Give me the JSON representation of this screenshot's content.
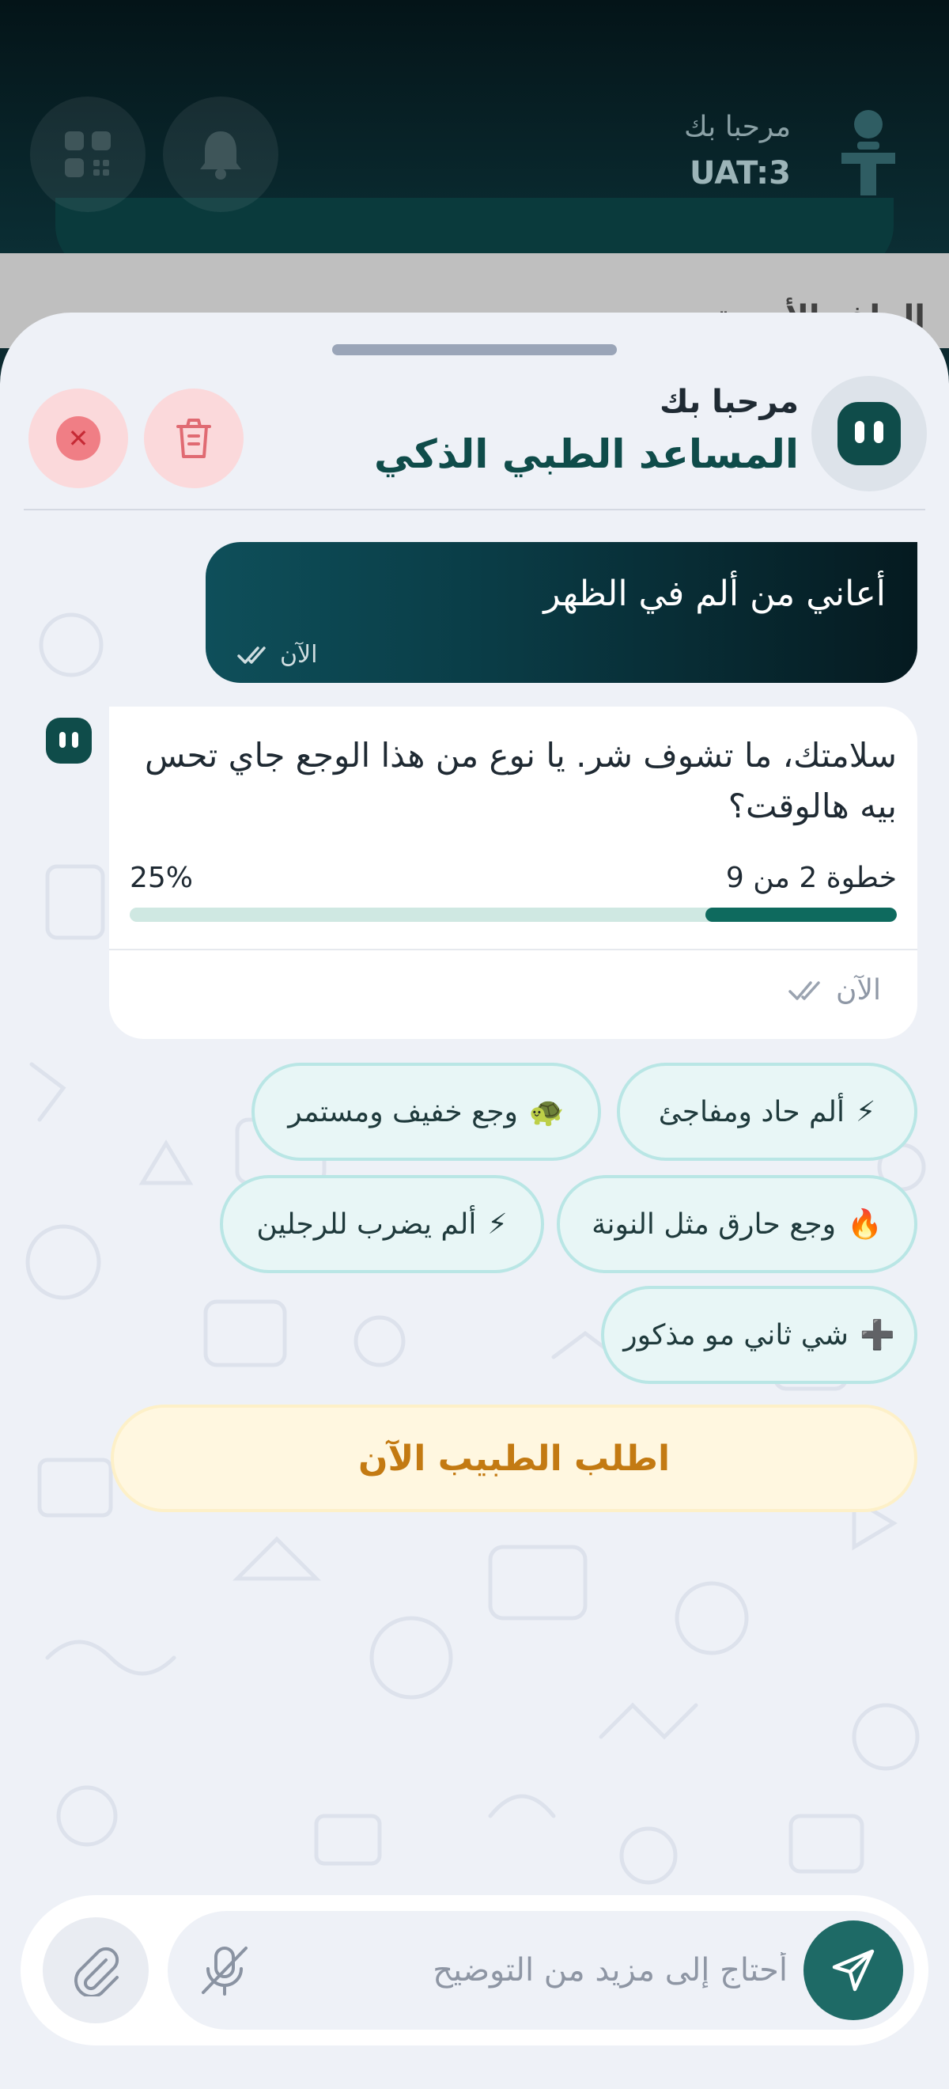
{
  "app_header": {
    "greeting": "مرحبا بك",
    "user_id": "UAT:3",
    "behind_text": "الملف الأسرة"
  },
  "sheet": {
    "greeting": "مرحبا بك",
    "title": "المساعد الطبي الذكي"
  },
  "messages": {
    "user": {
      "text": "أعاني من ألم في الظهر",
      "time": "الآن"
    },
    "bot": {
      "text": "سلامتك، ما تشوف شر. يا نوع من هذا الوجع جاي تحس بيه هالوقت؟",
      "step_label": "خطوة 2 من 9",
      "percent_label": "25%",
      "progress_fraction": 0.25,
      "time": "الآن"
    }
  },
  "options": [
    {
      "emoji": "⚡",
      "label": "ألم حاد ومفاجئ"
    },
    {
      "emoji": "🐢",
      "label": "وجع خفيف ومستمر"
    },
    {
      "emoji": "🔥",
      "label": "وجع حارق مثل النونة"
    },
    {
      "emoji": "⚡",
      "label": "ألم يضرب للرجلين"
    },
    {
      "emoji": "➕",
      "label": "شي ثاني مو مذكور"
    }
  ],
  "doctor_button": "اطلب الطبيب الآن",
  "composer": {
    "placeholder": "أحتاج إلى مزيد من التوضيح"
  },
  "colors": {
    "brand_dark": "#0f4c4a",
    "chip_bg": "#e8f6f6",
    "doctor_text": "#c37a12",
    "progress_fill": "#0e6a5e"
  }
}
